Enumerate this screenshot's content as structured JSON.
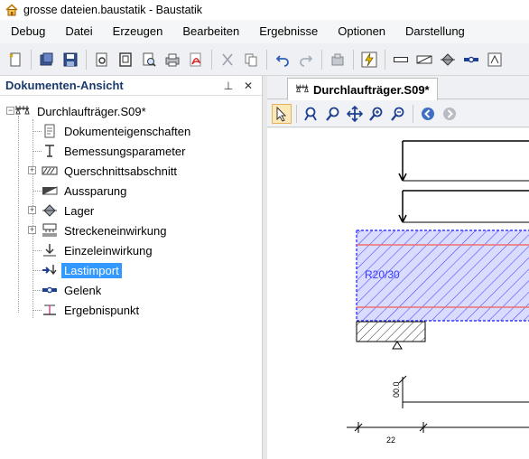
{
  "window": {
    "title": "grosse dateien.baustatik - Baustatik"
  },
  "menu": [
    {
      "label": "Debug"
    },
    {
      "label": "Datei"
    },
    {
      "label": "Erzeugen"
    },
    {
      "label": "Bearbeiten"
    },
    {
      "label": "Ergebnisse"
    },
    {
      "label": "Optionen"
    },
    {
      "label": "Darstellung"
    }
  ],
  "toolbar_icons": [
    "new-icon",
    "open-icon",
    "save-icon",
    "preview-icon",
    "page-icon",
    "print-preview-icon",
    "print-icon",
    "pdf-icon",
    "cut-icon",
    "copy-icon",
    "undo-icon",
    "redo-icon",
    "calc-icon",
    "lightning-icon",
    "beam-icon",
    "section-icon",
    "support-icon",
    "hinge-icon",
    "point-icon"
  ],
  "panel": {
    "title": "Dokumenten-Ansicht",
    "pin_glyph": "⊥",
    "close_glyph": "✕"
  },
  "tree": {
    "root": {
      "label": "Durchlaufträger.S09*",
      "icon": "beam-system-icon"
    },
    "items": [
      {
        "label": "Dokumenteigenschaften",
        "icon": "document-icon",
        "expandable": false
      },
      {
        "label": "Bemessungsparameter",
        "icon": "parameter-icon",
        "expandable": false
      },
      {
        "label": "Querschnittsabschnitt",
        "icon": "cross-section-icon",
        "expandable": true
      },
      {
        "label": "Aussparung",
        "icon": "opening-icon",
        "expandable": false
      },
      {
        "label": "Lager",
        "icon": "support-icon",
        "expandable": true
      },
      {
        "label": "Streckeneinwirkung",
        "icon": "distributed-load-icon",
        "expandable": true
      },
      {
        "label": "Einzeleinwirkung",
        "icon": "point-load-icon",
        "expandable": false
      },
      {
        "label": "Lastimport",
        "icon": "load-import-icon",
        "expandable": false,
        "selected": true
      },
      {
        "label": "Gelenk",
        "icon": "hinge-icon",
        "expandable": false
      },
      {
        "label": "Ergebnispunkt",
        "icon": "result-point-icon",
        "expandable": false
      }
    ]
  },
  "document_tab": {
    "label": "Durchlaufträger.S09*"
  },
  "doc_toolbar_icons": [
    "pointer-icon",
    "zoom-window-icon",
    "zoom-icon",
    "pan-icon",
    "zoom-in-icon",
    "zoom-out-icon",
    "back-icon",
    "forward-icon"
  ],
  "drawing": {
    "section_label": "R20/30",
    "dim_vertical": "00.0",
    "dim_horizontal": "22",
    "colors": {
      "hatch": "#3a3aff",
      "fill": "#d9dcff",
      "rebar": "#f07070",
      "line": "#000000"
    }
  }
}
